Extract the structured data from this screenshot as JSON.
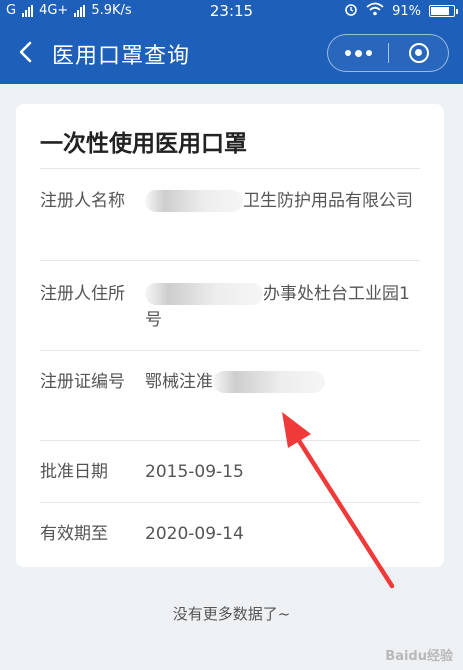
{
  "status": {
    "carrier_left": "G",
    "network": "4G+",
    "speed": "5.9K/s",
    "time": "23:15",
    "battery": "91%",
    "battery_level": 0.91
  },
  "navbar": {
    "title": "医用口罩查询",
    "back_icon": "chevron-left-icon",
    "more_icon": "more-dots-icon",
    "close_icon": "close-circle-icon"
  },
  "card": {
    "title": "一次性使用医用口罩",
    "rows": [
      {
        "label": "注册人名称",
        "value": "卫生防护用品有限公司"
      },
      {
        "label": "注册人住所",
        "value": "办事处杜台工业园1号"
      },
      {
        "label": "注册证编号",
        "value": "鄂械注准"
      },
      {
        "label": "批准日期",
        "value": "2015-09-15"
      },
      {
        "label": "有效期至",
        "value": "2020-09-14"
      }
    ]
  },
  "footer": {
    "text": "没有更多数据了~"
  },
  "watermark": {
    "text": "Baidu经验"
  },
  "colors": {
    "brand": "#1e5fb9",
    "background": "#eef1f4",
    "arrow": "#f03a3a"
  }
}
